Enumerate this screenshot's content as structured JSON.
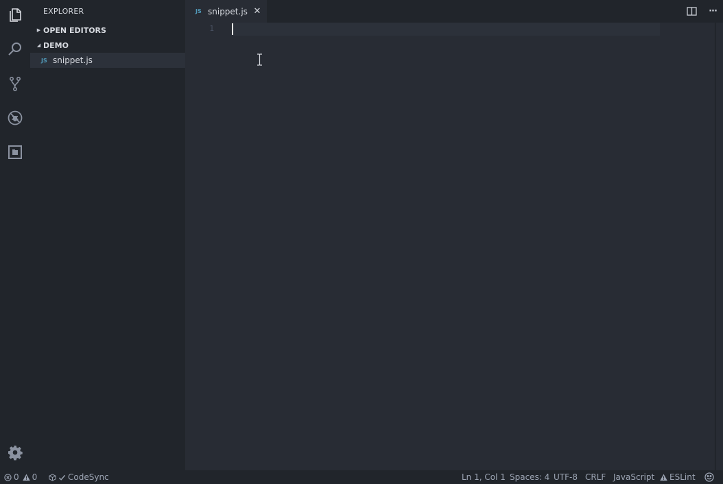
{
  "activity_bar": {
    "items": [
      {
        "name": "explorer",
        "icon": "files-icon"
      },
      {
        "name": "search",
        "icon": "search-icon"
      },
      {
        "name": "source-control",
        "icon": "git-branch-icon"
      },
      {
        "name": "debug",
        "icon": "bug-icon"
      },
      {
        "name": "extensions",
        "icon": "extensions-icon"
      }
    ],
    "settings_icon": "gear-icon"
  },
  "sidebar": {
    "title": "EXPLORER",
    "sections": [
      {
        "label": "OPEN EDITORS",
        "expanded": false
      },
      {
        "label": "DEMO",
        "expanded": true
      }
    ],
    "files": [
      {
        "badge": "JS",
        "name": "snippet.js",
        "selected": true
      }
    ]
  },
  "tabs": [
    {
      "badge": "JS",
      "label": "snippet.js",
      "close_glyph": "✕",
      "active": true
    }
  ],
  "tab_actions": {
    "split_icon": "split-editor-icon",
    "more_glyph": "···"
  },
  "editor": {
    "line_numbers": [
      "1"
    ],
    "lines": [
      ""
    ],
    "cursor_line": 1
  },
  "statusbar": {
    "errors": "0",
    "warnings": "0",
    "codesync": "CodeSync",
    "position": "Ln 1, Col 1",
    "indent": "Spaces: 4",
    "encoding": "UTF-8",
    "eol": "CRLF",
    "language": "JavaScript",
    "linter": "ESLint"
  },
  "colors": {
    "background": "#282c34",
    "sidebar": "#21252b",
    "accent_js": "#519aba",
    "text": "#d7dae0",
    "muted": "#9da5b4"
  }
}
